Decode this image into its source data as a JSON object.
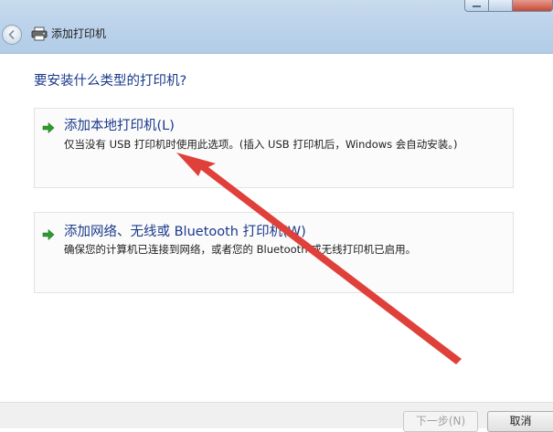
{
  "window": {
    "title": "添加打印机"
  },
  "content": {
    "question": "要安装什么类型的打印机?",
    "options": [
      {
        "title": "添加本地打印机(L)",
        "description": "仅当没有 USB 打印机时使用此选项。(插入 USB 打印机后，Windows 会自动安装。)"
      },
      {
        "title": "添加网络、无线或 Bluetooth 打印机(W)",
        "description": "确保您的计算机已连接到网络，或者您的 Bluetooth 或无线打印机已启用。"
      }
    ]
  },
  "footer": {
    "next_label": "下一步(N)",
    "cancel_label": "取消"
  },
  "icons": {
    "back": "back-arrow-icon",
    "printer": "printer-icon",
    "option_arrow": "green-arrow-icon"
  },
  "colors": {
    "link_blue": "#1a3a8a",
    "option_arrow_green": "#2e9b2e",
    "annotation_red": "#e0403a"
  }
}
